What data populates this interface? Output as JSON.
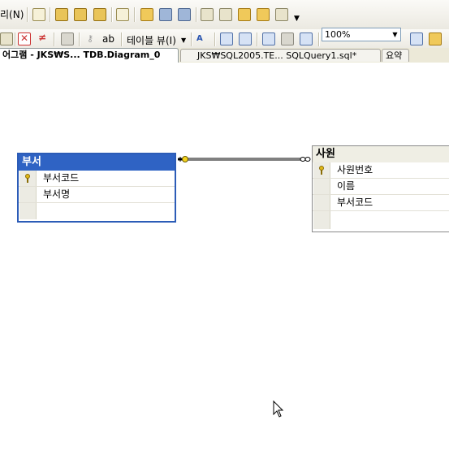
{
  "toolbar1": {
    "menu_fragment": "리(N)"
  },
  "toolbar2": {
    "table_view_label": "테이블 뷰(I)",
    "ab_label": "ab",
    "zoom_value": "100%"
  },
  "tabs": [
    {
      "label": "어그램 - JKS₩S... TDB.Diagram_0",
      "active": true
    },
    {
      "label": "JKS₩SQL2005.TE... SQLQuery1.sql*",
      "active": false
    },
    {
      "label": "요약",
      "active": false
    }
  ],
  "diagram": {
    "tables": [
      {
        "title": "부서",
        "columns": [
          {
            "name": "부서코드",
            "primary_key": true
          },
          {
            "name": "부서명",
            "primary_key": false
          }
        ]
      },
      {
        "title": "사원",
        "columns": [
          {
            "name": "사원번호",
            "primary_key": true
          },
          {
            "name": "이름",
            "primary_key": false
          },
          {
            "name": "부서코드",
            "primary_key": false
          }
        ]
      }
    ],
    "relationship": {
      "from": "부서",
      "to": "사원"
    }
  },
  "colors": {
    "selected_table_header": "#2f63c4",
    "table_header": "#efeee4",
    "toolbar_bg": "#ebe9e1"
  },
  "icons": {
    "pk": "primary-key-icon",
    "relationship_key_end": "key-end-icon",
    "relationship_many_end": "infinity-end-icon",
    "cursor": "mouse-pointer-icon"
  }
}
